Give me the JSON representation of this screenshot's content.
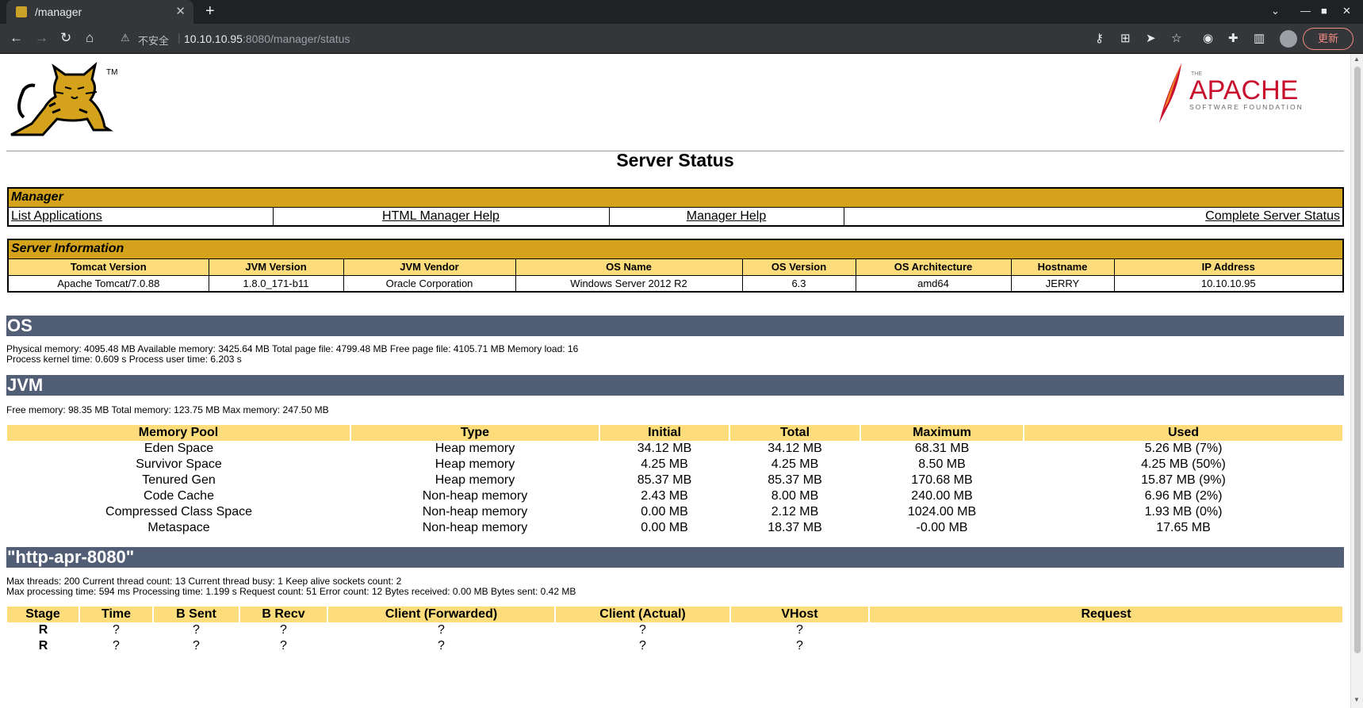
{
  "browser": {
    "tab_title": "/manager",
    "insecure_label": "不安全",
    "url_host": "10.10.10.95",
    "url_rest": ":8080/manager/status",
    "update_label": "更新"
  },
  "page": {
    "title": "Server Status"
  },
  "manager": {
    "section": "Manager",
    "links": {
      "list_applications": "List Applications",
      "html_manager_help": "HTML Manager Help",
      "manager_help": "Manager Help",
      "complete_server_status": "Complete Server Status"
    }
  },
  "server_info": {
    "section": "Server Information",
    "headers": [
      "Tomcat Version",
      "JVM Version",
      "JVM Vendor",
      "OS Name",
      "OS Version",
      "OS Architecture",
      "Hostname",
      "IP Address"
    ],
    "values": [
      "Apache Tomcat/7.0.88",
      "1.8.0_171-b11",
      "Oracle Corporation",
      "Windows Server 2012 R2",
      "6.3",
      "amd64",
      "JERRY",
      "10.10.10.95"
    ]
  },
  "os": {
    "heading": "OS",
    "line1": "Physical memory: 4095.48 MB Available memory: 3425.64 MB Total page file: 4799.48 MB Free page file: 4105.71 MB Memory load: 16",
    "line2": "Process kernel time: 0.609 s Process user time: 6.203 s"
  },
  "jvm": {
    "heading": "JVM",
    "line1": "Free memory: 98.35 MB Total memory: 123.75 MB Max memory: 247.50 MB",
    "headers": [
      "Memory Pool",
      "Type",
      "Initial",
      "Total",
      "Maximum",
      "Used"
    ],
    "rows": [
      [
        "Eden Space",
        "Heap memory",
        "34.12 MB",
        "34.12 MB",
        "68.31 MB",
        "5.26 MB (7%)"
      ],
      [
        "Survivor Space",
        "Heap memory",
        "4.25 MB",
        "4.25 MB",
        "8.50 MB",
        "4.25 MB (50%)"
      ],
      [
        "Tenured Gen",
        "Heap memory",
        "85.37 MB",
        "85.37 MB",
        "170.68 MB",
        "15.87 MB (9%)"
      ],
      [
        "Code Cache",
        "Non-heap memory",
        "2.43 MB",
        "8.00 MB",
        "240.00 MB",
        "6.96 MB (2%)"
      ],
      [
        "Compressed Class Space",
        "Non-heap memory",
        "0.00 MB",
        "2.12 MB",
        "1024.00 MB",
        "1.93 MB (0%)"
      ],
      [
        "Metaspace",
        "Non-heap memory",
        "0.00 MB",
        "18.37 MB",
        "-0.00 MB",
        "17.65 MB"
      ]
    ]
  },
  "connector": {
    "heading": "\"http-apr-8080\"",
    "line1": "Max threads: 200 Current thread count: 13 Current thread busy: 1 Keep alive sockets count: 2",
    "line2": "Max processing time: 594 ms Processing time: 1.199 s Request count: 51 Error count: 12 Bytes received: 0.00 MB Bytes sent: 0.42 MB",
    "headers": [
      "Stage",
      "Time",
      "B Sent",
      "B Recv",
      "Client (Forwarded)",
      "Client (Actual)",
      "VHost",
      "Request"
    ],
    "rows": [
      [
        "R",
        "?",
        "?",
        "?",
        "?",
        "?",
        "?",
        ""
      ],
      [
        "R",
        "?",
        "?",
        "?",
        "?",
        "?",
        "?",
        ""
      ]
    ]
  },
  "logos": {
    "tomcat_tm": "TM",
    "apache_the": "THE",
    "apache_name": "APACHE",
    "apache_sub": "SOFTWARE FOUNDATION"
  }
}
